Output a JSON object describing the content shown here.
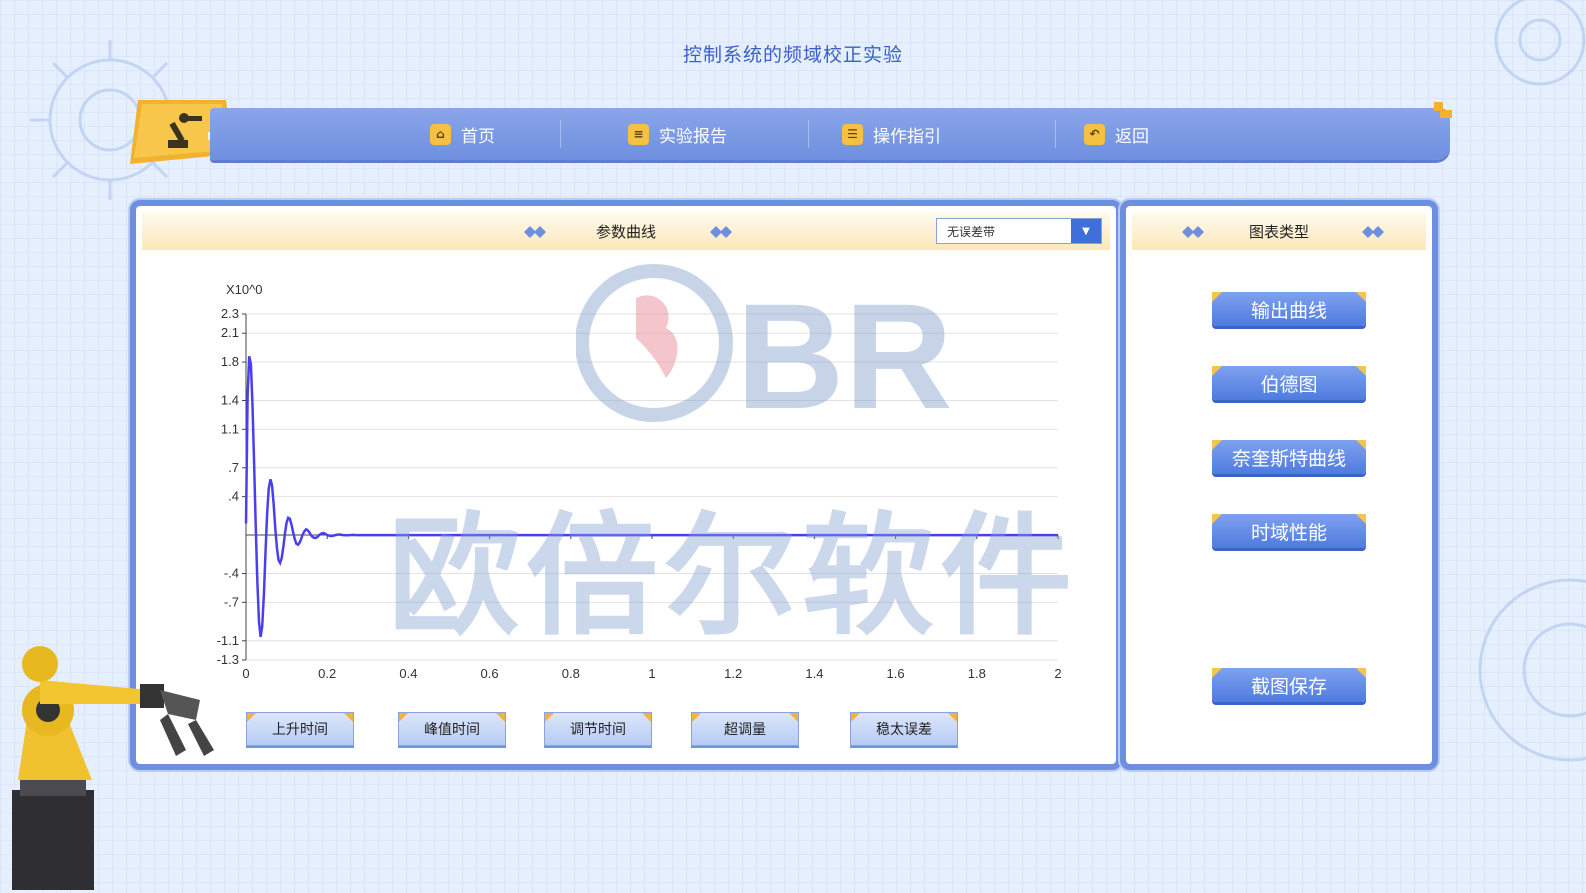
{
  "app": {
    "title": "控制系统的频域校正实验"
  },
  "nav": {
    "items": [
      {
        "label": "首页",
        "icon": "home-icon"
      },
      {
        "label": "实验报告",
        "icon": "report-icon"
      },
      {
        "label": "操作指引",
        "icon": "guide-icon"
      },
      {
        "label": "返回",
        "icon": "back-icon"
      }
    ]
  },
  "main_panel": {
    "title": "参数曲线",
    "select_value": "无误差带",
    "metric_buttons": [
      "上升时间",
      "峰值时间",
      "调节时间",
      "超调量",
      "稳太误差"
    ]
  },
  "side_panel": {
    "title": "图表类型",
    "buttons": [
      "输出曲线",
      "伯德图",
      "奈奎斯特曲线",
      "时域性能"
    ],
    "save_button": "截图保存"
  },
  "watermark": {
    "text": "欧倍尔软件",
    "logo_text": "BR"
  },
  "colors": {
    "accent": "#6e8fe0",
    "nav": "#7b98e4",
    "gold": "#f5c44a",
    "curve": "#4a3ff0"
  },
  "chart_data": {
    "type": "line",
    "exponent_label": "X10^0",
    "xlim": [
      0,
      2
    ],
    "ylim": [
      -1.3,
      2.3
    ],
    "x_ticks": [
      "0",
      "0.2",
      "0.4",
      "0.6",
      "0.8",
      "1",
      "1.2",
      "1.4",
      "1.6",
      "1.8",
      "2"
    ],
    "y_ticks": [
      "2.3",
      "2.1",
      "1.8",
      "1.4",
      "1.1",
      ".7",
      ".4",
      "-.4",
      "-.7",
      "-1.1",
      "-1.3"
    ],
    "y_tick_values": [
      2.3,
      2.1,
      1.8,
      1.4,
      1.1,
      0.7,
      0.4,
      -0.4,
      -0.7,
      -1.1,
      -1.3
    ],
    "series": [
      {
        "x": [
          0,
          0.004,
          0.008,
          0.012,
          0.016,
          0.02,
          0.024,
          0.028,
          0.032,
          0.036,
          0.04,
          0.044,
          0.048,
          0.052,
          0.056,
          0.06,
          0.064,
          0.068,
          0.072,
          0.076,
          0.08,
          0.084,
          0.088,
          0.092,
          0.096,
          0.1,
          0.104,
          0.108,
          0.112,
          0.116,
          0.12,
          0.124,
          0.128,
          0.132,
          0.136,
          0.14,
          0.144,
          0.148,
          0.152,
          0.156,
          0.16,
          0.164,
          0.168,
          0.172,
          0.176,
          0.18,
          0.184,
          0.188,
          0.192,
          0.196,
          0.2,
          0.204,
          0.208,
          0.212,
          0.216,
          0.22,
          0.224,
          0.228,
          0.232,
          0.236,
          0.24,
          0.244,
          0.248,
          0.252,
          0.256,
          0.26,
          0.264,
          0.268,
          0.272,
          0.276,
          0.28,
          0.284,
          0.288,
          0.292,
          0.296,
          0.3,
          0.32,
          0.34,
          0.36,
          0.38,
          0.4,
          0.5,
          0.6,
          0.8,
          1.0,
          1.2,
          1.4,
          1.6,
          1.8,
          2.0
        ],
        "y": [
          0.12,
          1.45,
          1.86,
          1.78,
          1.35,
          0.75,
          0.1,
          -0.5,
          -0.9,
          -1.06,
          -0.95,
          -0.62,
          -0.18,
          0.22,
          0.48,
          0.58,
          0.52,
          0.33,
          0.08,
          -0.13,
          -0.26,
          -0.29,
          -0.24,
          -0.12,
          0.02,
          0.13,
          0.18,
          0.17,
          0.11,
          0.03,
          -0.04,
          -0.09,
          -0.1,
          -0.08,
          -0.04,
          0.01,
          0.04,
          0.06,
          0.05,
          0.03,
          0.0,
          -0.02,
          -0.03,
          -0.03,
          -0.02,
          0.0,
          0.01,
          0.02,
          0.02,
          0.01,
          0.0,
          -0.005,
          -0.01,
          -0.01,
          -0.005,
          0.0,
          0.004,
          0.006,
          0.005,
          0.002,
          0.0,
          -0.002,
          -0.003,
          -0.002,
          0.0,
          0.001,
          0.002,
          0.001,
          0.0,
          0.0,
          0.0,
          0.0,
          0.0,
          0.0,
          0.0,
          0.0,
          0.0,
          0.0,
          0.0,
          0.0,
          0.0,
          0.0,
          0.0,
          0.0,
          0.0,
          0.0,
          0.0,
          0.0,
          0.0,
          0.0
        ]
      }
    ],
    "grid": true
  }
}
